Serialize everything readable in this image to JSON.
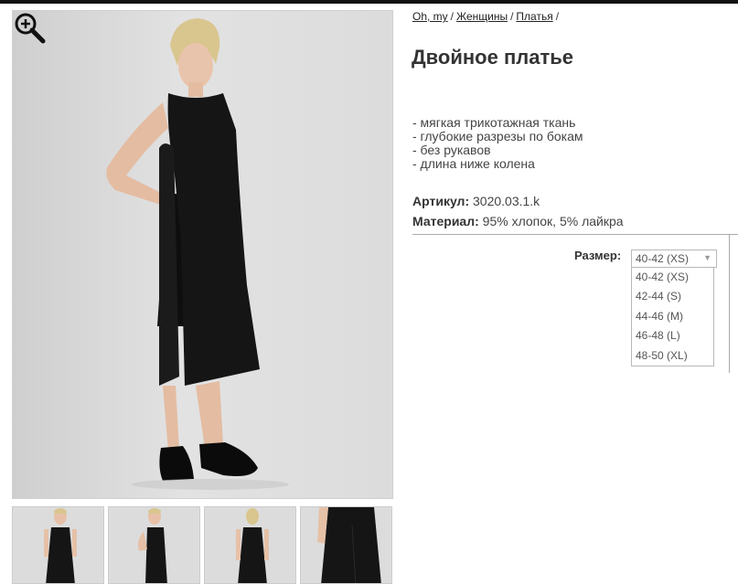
{
  "breadcrumb": [
    {
      "label": "Oh, my"
    },
    {
      "label": "Женщины"
    },
    {
      "label": "Платья"
    }
  ],
  "breadcrumb_separator": "/",
  "product": {
    "title": "Двойное платье",
    "features": [
      "- мягкая трикотажная ткань",
      "- глубокие разрезы по бокам",
      "- без рукавов",
      "- длина ниже колена"
    ],
    "article_label": "Артикул:",
    "article_value": "3020.03.1.k",
    "material_label": "Материал:",
    "material_value": "95% хлопок, 5% лайкра"
  },
  "size": {
    "label": "Размер:",
    "selected": "40-42 (XS)",
    "options": [
      "40-42 (XS)",
      "42-44 (S)",
      "44-46 (M)",
      "46-48 (L)",
      "48-50 (XL)"
    ]
  },
  "icons": {
    "zoom": "zoom-in-icon",
    "dropdown": "chevron-down-icon"
  },
  "colors": {
    "dress": "#151515",
    "photo_bg": "#dcdcdc",
    "top_bar": "#111111"
  }
}
